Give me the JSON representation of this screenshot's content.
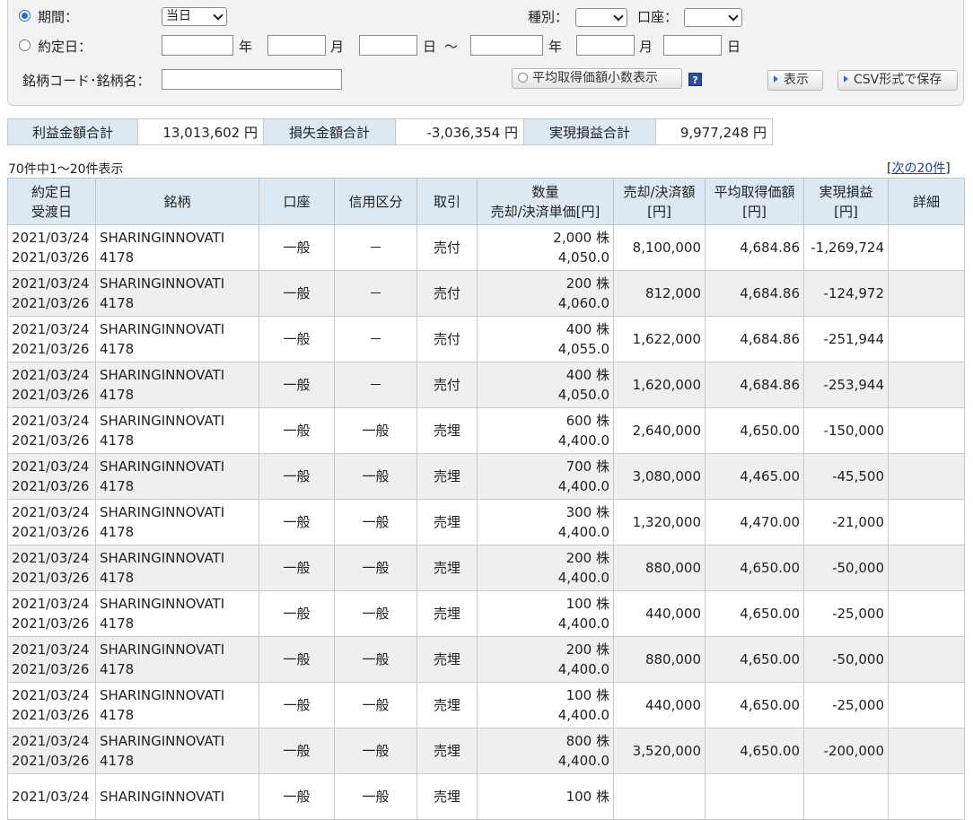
{
  "filter": {
    "period_label": "期間：",
    "period_value": "当日",
    "tradedate_label": "約定日：",
    "year_label": "年",
    "month_label": "月",
    "day_label": "日",
    "tilde": "～",
    "type_label": "種別：",
    "account_label": "口座：",
    "code_label": "銘柄コード･銘柄名：",
    "avg_button": "平均取得価額小数表示",
    "help_label": "?",
    "display_button": "表示",
    "csv_button": "CSV形式で保存"
  },
  "summary": {
    "profit_label": "利益金額合計",
    "profit_value": "13,013,602",
    "loss_label": "損失金額合計",
    "loss_value": "-3,036,354",
    "realized_label": "実現損益合計",
    "realized_value": "9,977,248",
    "yen": "円"
  },
  "paging": {
    "count_text": "70件中1～20件表示",
    "bracket_open": "[",
    "next_link": "次の20件",
    "bracket_close": "]"
  },
  "table": {
    "headers": {
      "date1": "約定日",
      "date2": "受渡日",
      "stock": "銘柄",
      "account": "口座",
      "credit": "信用区分",
      "trade": "取引",
      "qty1": "数量",
      "qty2": "売却/決済単価[円]",
      "sale1": "売却/決済額",
      "sale2": "[円]",
      "avg1": "平均取得価額",
      "avg2": "[円]",
      "pl1": "実現損益",
      "pl2": "[円]",
      "detail": "詳細"
    },
    "rows": [
      {
        "trade_date": "2021/03/24",
        "settle_date": "2021/03/26",
        "name": "SHARINGINNOVATI",
        "code": "4178",
        "account": "一般",
        "credit": "－",
        "trade": "売付",
        "qty": "2,000 株",
        "price": "4,050.0",
        "amount": "8,100,000",
        "avg": "4,684.86",
        "pl": "-1,269,724"
      },
      {
        "trade_date": "2021/03/24",
        "settle_date": "2021/03/26",
        "name": "SHARINGINNOVATI",
        "code": "4178",
        "account": "一般",
        "credit": "－",
        "trade": "売付",
        "qty": "200 株",
        "price": "4,060.0",
        "amount": "812,000",
        "avg": "4,684.86",
        "pl": "-124,972"
      },
      {
        "trade_date": "2021/03/24",
        "settle_date": "2021/03/26",
        "name": "SHARINGINNOVATI",
        "code": "4178",
        "account": "一般",
        "credit": "－",
        "trade": "売付",
        "qty": "400 株",
        "price": "4,055.0",
        "amount": "1,622,000",
        "avg": "4,684.86",
        "pl": "-251,944"
      },
      {
        "trade_date": "2021/03/24",
        "settle_date": "2021/03/26",
        "name": "SHARINGINNOVATI",
        "code": "4178",
        "account": "一般",
        "credit": "－",
        "trade": "売付",
        "qty": "400 株",
        "price": "4,050.0",
        "amount": "1,620,000",
        "avg": "4,684.86",
        "pl": "-253,944"
      },
      {
        "trade_date": "2021/03/24",
        "settle_date": "2021/03/26",
        "name": "SHARINGINNOVATI",
        "code": "4178",
        "account": "一般",
        "credit": "一般",
        "trade": "売埋",
        "qty": "600 株",
        "price": "4,400.0",
        "amount": "2,640,000",
        "avg": "4,650.00",
        "pl": "-150,000"
      },
      {
        "trade_date": "2021/03/24",
        "settle_date": "2021/03/26",
        "name": "SHARINGINNOVATI",
        "code": "4178",
        "account": "一般",
        "credit": "一般",
        "trade": "売埋",
        "qty": "700 株",
        "price": "4,400.0",
        "amount": "3,080,000",
        "avg": "4,465.00",
        "pl": "-45,500"
      },
      {
        "trade_date": "2021/03/24",
        "settle_date": "2021/03/26",
        "name": "SHARINGINNOVATI",
        "code": "4178",
        "account": "一般",
        "credit": "一般",
        "trade": "売埋",
        "qty": "300 株",
        "price": "4,400.0",
        "amount": "1,320,000",
        "avg": "4,470.00",
        "pl": "-21,000"
      },
      {
        "trade_date": "2021/03/24",
        "settle_date": "2021/03/26",
        "name": "SHARINGINNOVATI",
        "code": "4178",
        "account": "一般",
        "credit": "一般",
        "trade": "売埋",
        "qty": "200 株",
        "price": "4,400.0",
        "amount": "880,000",
        "avg": "4,650.00",
        "pl": "-50,000"
      },
      {
        "trade_date": "2021/03/24",
        "settle_date": "2021/03/26",
        "name": "SHARINGINNOVATI",
        "code": "4178",
        "account": "一般",
        "credit": "一般",
        "trade": "売埋",
        "qty": "100 株",
        "price": "4,400.0",
        "amount": "440,000",
        "avg": "4,650.00",
        "pl": "-25,000"
      },
      {
        "trade_date": "2021/03/24",
        "settle_date": "2021/03/26",
        "name": "SHARINGINNOVATI",
        "code": "4178",
        "account": "一般",
        "credit": "一般",
        "trade": "売埋",
        "qty": "200 株",
        "price": "4,400.0",
        "amount": "880,000",
        "avg": "4,650.00",
        "pl": "-50,000"
      },
      {
        "trade_date": "2021/03/24",
        "settle_date": "2021/03/26",
        "name": "SHARINGINNOVATI",
        "code": "4178",
        "account": "一般",
        "credit": "一般",
        "trade": "売埋",
        "qty": "100 株",
        "price": "4,400.0",
        "amount": "440,000",
        "avg": "4,650.00",
        "pl": "-25,000"
      },
      {
        "trade_date": "2021/03/24",
        "settle_date": "2021/03/26",
        "name": "SHARINGINNOVATI",
        "code": "4178",
        "account": "一般",
        "credit": "一般",
        "trade": "売埋",
        "qty": "800 株",
        "price": "4,400.0",
        "amount": "3,520,000",
        "avg": "4,650.00",
        "pl": "-200,000"
      },
      {
        "trade_date": "2021/03/24",
        "settle_date": "",
        "name": "SHARINGINNOVATI",
        "code": "",
        "account": "一般",
        "credit": "一般",
        "trade": "売埋",
        "qty": "100 株",
        "price": "",
        "amount": "",
        "avg": "",
        "pl": ""
      }
    ]
  }
}
